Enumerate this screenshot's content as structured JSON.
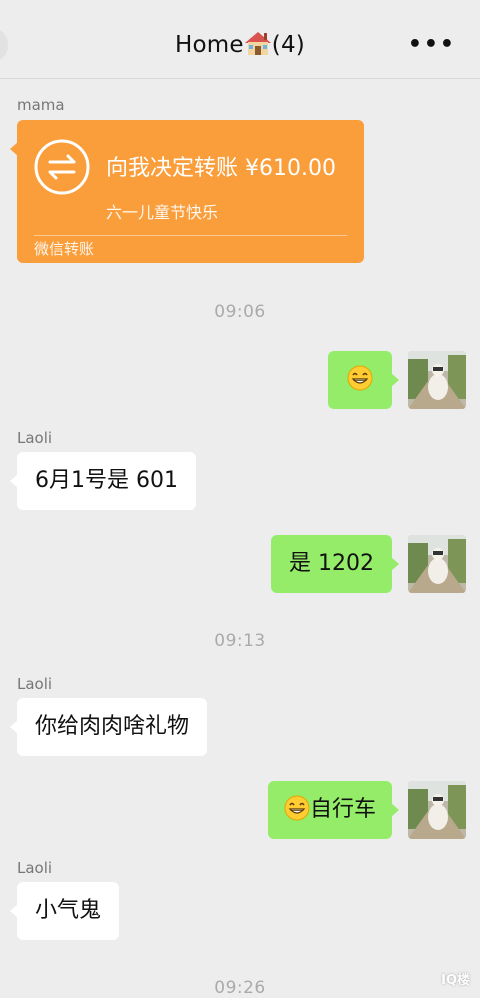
{
  "header": {
    "title": "Home",
    "title_suffix": "(4)",
    "house_icon": "house-emoji",
    "more_icon": "more-icon"
  },
  "messages": {
    "transfer": {
      "sender": "mama",
      "amount_text": "向我决定转账 ¥610.00",
      "note": "六一儿童节快乐",
      "footer": "微信转账",
      "color": "#fa9d3b"
    },
    "time1": "09:06",
    "msg_emoji": {
      "icon": "grin-emoji"
    },
    "laoli1": {
      "sender": "Laoli",
      "text": "6月1号是 601"
    },
    "reply1": {
      "text": "是 1202"
    },
    "time2": "09:13",
    "laoli2": {
      "sender": "Laoli",
      "text": "你给肉肉啥礼物"
    },
    "reply2": {
      "text": "自行车",
      "icon": "grin-emoji"
    },
    "laoli3": {
      "sender": "Laoli",
      "text": "小气鬼"
    },
    "time3": "09:26"
  },
  "watermark": "IQ楼",
  "colors": {
    "background": "#ededed",
    "bubble_self": "#95ec69",
    "bubble_other": "#ffffff",
    "transfer": "#fa9d3b"
  }
}
